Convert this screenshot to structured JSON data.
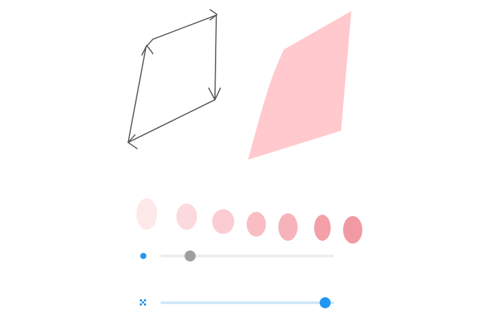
{
  "colors": {
    "stroke": "#555555",
    "fill_shape": "#ffc9cd",
    "accent": "#2196f3",
    "track": "#e9e9e9",
    "track_active": "#cfe8fb",
    "thumb_gray": "#9e9e9e"
  },
  "drawing": {
    "outline_tool": "pencil-stroke",
    "filled_tool": "highlighter-fill"
  },
  "opacity_swatches": [
    {
      "color": "#fde8ea",
      "opacity": 0.25
    },
    {
      "color": "#fbd9dd",
      "opacity": 0.35
    },
    {
      "color": "#fbcdd2",
      "opacity": 0.45
    },
    {
      "color": "#f9bec4",
      "opacity": 0.55
    },
    {
      "color": "#f7b3ba",
      "opacity": 0.65
    },
    {
      "color": "#f3a0a9",
      "opacity": 0.75
    },
    {
      "color": "#f19aa3",
      "opacity": 0.85
    }
  ],
  "sliders": {
    "size": {
      "icon": "dot-icon",
      "value": 0.17
    },
    "opacity": {
      "icon": "transparency-icon",
      "value": 0.95
    }
  }
}
